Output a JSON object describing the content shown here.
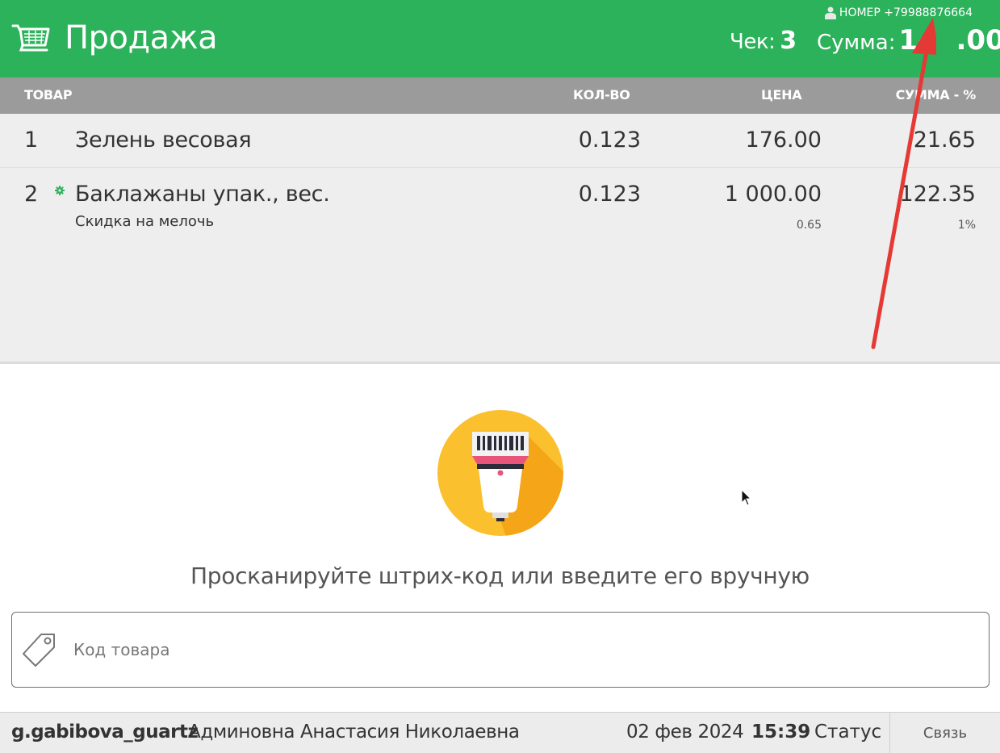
{
  "header": {
    "title": "Продажа",
    "customer_label": "НОМЕР +79988876664",
    "check_label": "Чек:",
    "check_number": "3",
    "sum_label": "Сумма:",
    "sum_value": "14  .00",
    "background_color": "#2bb25a"
  },
  "table": {
    "columns": [
      "ТОВАР",
      "КОЛ-ВО",
      "ЦЕНА",
      "СУММА - %"
    ],
    "rows": [
      {
        "index": "1",
        "name": "Зелень весовая",
        "subtitle": "",
        "qty": "0.123",
        "price": "176.00",
        "price_sub": "",
        "total": "21.65",
        "total_sub": ""
      },
      {
        "index": "2",
        "name": "Баклажаны упак., вес.",
        "subtitle": "Скидка на мелочь",
        "qty": "0.123",
        "price": "1 000.00",
        "price_sub": "0.65",
        "total": "122.35",
        "total_sub": "1%"
      }
    ]
  },
  "scan": {
    "prompt": "Просканируйте штрих-код или введите его вручную",
    "icon": "barcode-scanner-icon"
  },
  "code_input": {
    "placeholder": "Код товара",
    "value": "",
    "icon": "tag-icon"
  },
  "footer": {
    "login": "g.gabibova_guartz",
    "full_name": "Админовна Анастасия Николаевна",
    "date": "02 фев 2024",
    "time": "15:39",
    "status": "Статус",
    "contact_button": "Связь"
  },
  "annotation": {
    "arrow_color": "#e53935"
  }
}
